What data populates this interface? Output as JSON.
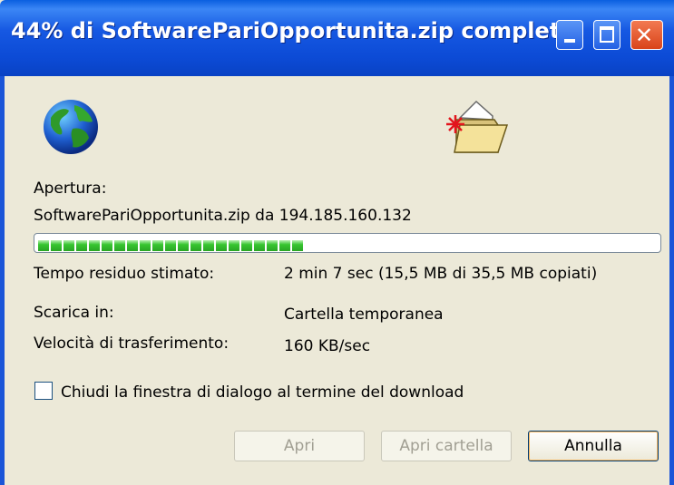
{
  "window": {
    "title": "44% di SoftwarePariOpportunita.zip complet...",
    "controls": {
      "minimize": "minimize",
      "maximize": "maximize",
      "close": "✕"
    }
  },
  "icons": {
    "globe": "globe-icon",
    "folder": "open-folder-icon"
  },
  "status": {
    "opening_label": "Apertura:",
    "source_text": "SoftwarePariOpportunita.zip da 194.185.160.132",
    "progress_percent": 44
  },
  "details": {
    "time_label": "Tempo residuo stimato:",
    "time_value": "2 min 7 sec (15,5 MB di 35,5 MB copiati)",
    "download_to_label": "Scarica in:",
    "download_to_value": "Cartella temporanea",
    "rate_label": "Velocità di trasferimento:",
    "rate_value": "160 KB/sec"
  },
  "options": {
    "close_on_complete_label": "Chiudi la finestra di dialogo al termine del download",
    "close_on_complete_checked": false
  },
  "buttons": {
    "open": "Apri",
    "open_folder": "Apri cartella",
    "cancel": "Annulla"
  },
  "colors": {
    "titlebar": "#0c4bd6",
    "progress": "#37c530",
    "close_button": "#d9441a"
  }
}
